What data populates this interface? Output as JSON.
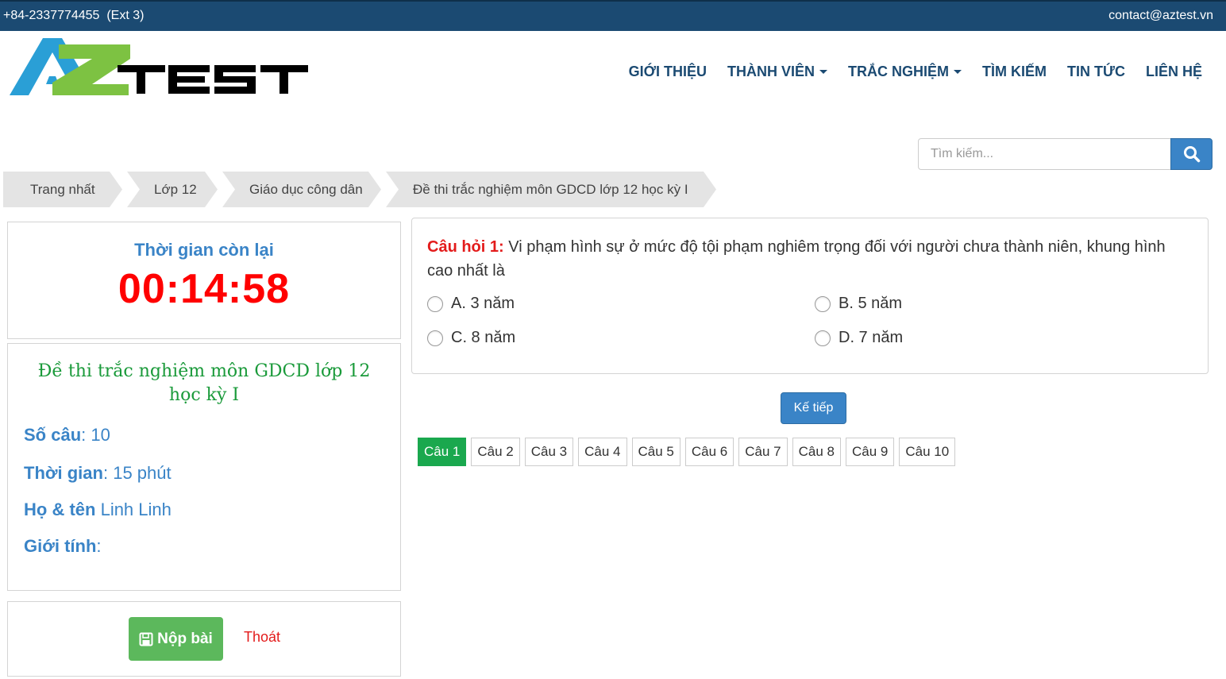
{
  "topbar": {
    "phone": "+84-2337774455",
    "ext": "(Ext 3)",
    "email": "contact@aztest.vn"
  },
  "logo": {
    "text": "AZTEST"
  },
  "nav": {
    "items": [
      {
        "label": "GIỚI THIỆU",
        "dropdown": false
      },
      {
        "label": "THÀNH VIÊN",
        "dropdown": true
      },
      {
        "label": "TRẮC NGHIỆM",
        "dropdown": true
      },
      {
        "label": "TÌM KIẾM",
        "dropdown": false
      },
      {
        "label": "TIN TỨC",
        "dropdown": false
      },
      {
        "label": "LIÊN HỆ",
        "dropdown": false
      }
    ]
  },
  "search": {
    "placeholder": "Tìm kiếm...",
    "value": "",
    "icon": "search-icon"
  },
  "breadcrumb": [
    "Trang nhất",
    "Lớp 12",
    "Giáo dục công dân",
    "Đề thi trắc nghiệm môn GDCD lớp 12 học kỳ I"
  ],
  "timer": {
    "label": "Thời gian còn lại",
    "value": "00:14:58"
  },
  "exam": {
    "title": "Đề thi trắc nghiệm môn GDCD lớp 12 học kỳ I",
    "count_label": "Số câu",
    "count_value": "10",
    "time_label": "Thời gian",
    "time_value": "15 phút",
    "name_label": "Họ & tên",
    "name_value": "Linh Linh",
    "gender_label": "Giới tính",
    "gender_value": ""
  },
  "actions": {
    "submit_label": "Nộp bài",
    "exit_label": "Thoát"
  },
  "question": {
    "number_label": "Câu hỏi 1:",
    "text": "Vi phạm hình sự ở mức độ tội phạm nghiêm trọng đối với người chưa thành niên, khung hình cao nhất là",
    "options": [
      "A. 3 năm",
      "B. 5 năm",
      "C. 8 năm",
      "D. 7 năm"
    ]
  },
  "next_label": "Kế tiếp",
  "question_nav": {
    "active_index": 0,
    "items": [
      "Câu 1",
      "Câu 2",
      "Câu 3",
      "Câu 4",
      "Câu 5",
      "Câu 6",
      "Câu 7",
      "Câu 8",
      "Câu 9",
      "Câu 10"
    ]
  },
  "colors": {
    "topbar": "#1b4a72",
    "primary": "#3a84c7",
    "timer": "#ff0000",
    "exam_title": "#1a9a3a",
    "submit": "#5cb85c",
    "active_question": "#1aa84e"
  }
}
